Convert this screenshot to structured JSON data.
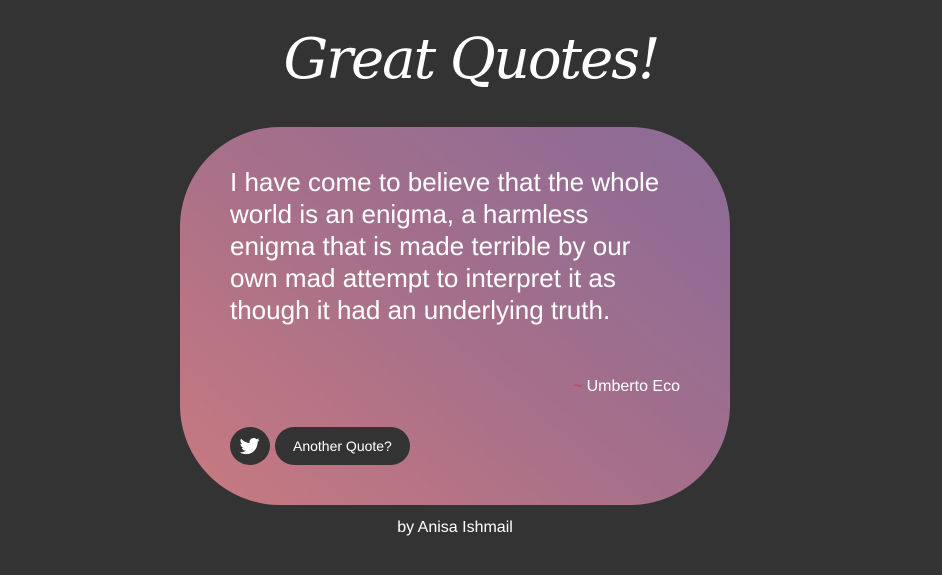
{
  "header": {
    "title": "Great Quotes!"
  },
  "quote": {
    "text": "I have come to believe that the whole world is an enigma, a harmless enigma that is made terrible by our own mad attempt to interpret it as though it had an underlying truth.",
    "author_prefix": "~",
    "author": "Umberto Eco"
  },
  "actions": {
    "tweet_icon": "twitter-icon",
    "another_quote_label": "Another Quote?"
  },
  "footer": {
    "credit": "by Anisa Ishmail"
  },
  "colors": {
    "background": "#333333",
    "card_gradient_start": "#c97a7f",
    "card_gradient_end": "#8a6b98",
    "author_prefix": "#e03a3a",
    "button_background": "#333333",
    "text": "#ffffff"
  }
}
